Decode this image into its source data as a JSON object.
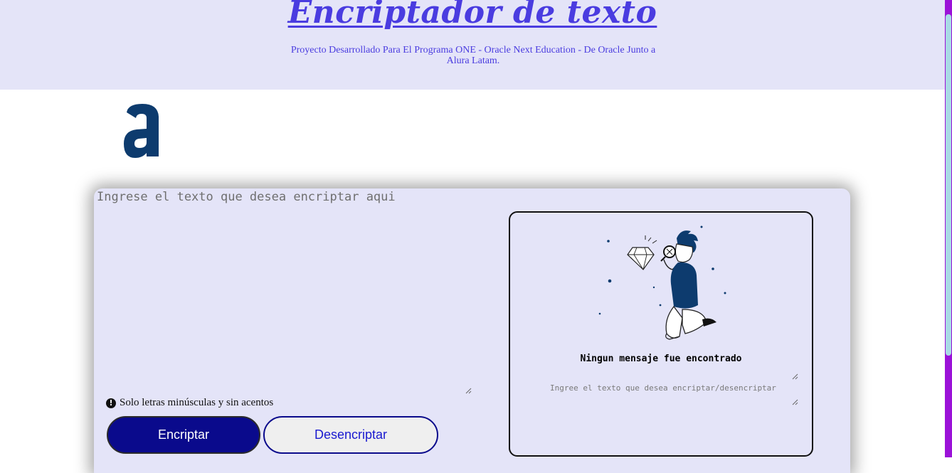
{
  "header": {
    "title": "Encriptador de texto",
    "subtitle": "Proyecto Desarrollado Para El Programa ONE - Oracle Next Education - De Oracle Junto a Alura Latam."
  },
  "logo": {
    "icon": "alura-logo-icon",
    "color": "#0d3b6e"
  },
  "encoder": {
    "input_placeholder": "Ingrese el texto que desea encriptar aqui",
    "hint": "Solo letras minúsculas y sin acentos",
    "encrypt_label": "Encriptar",
    "decrypt_label": "Desencriptar"
  },
  "result": {
    "empty_message": "Ningun mensaje fue encontrado",
    "output_placeholder": "Ingree el texto que desea encriptar/desencriptar"
  },
  "colors": {
    "accent": "#4a3ce0",
    "primary_button": "#0a0a8c",
    "panel_bg": "#e4e4f8",
    "scrollbar_track": "#9b12d8",
    "scrollbar_thumb": "#a9dbe5"
  }
}
